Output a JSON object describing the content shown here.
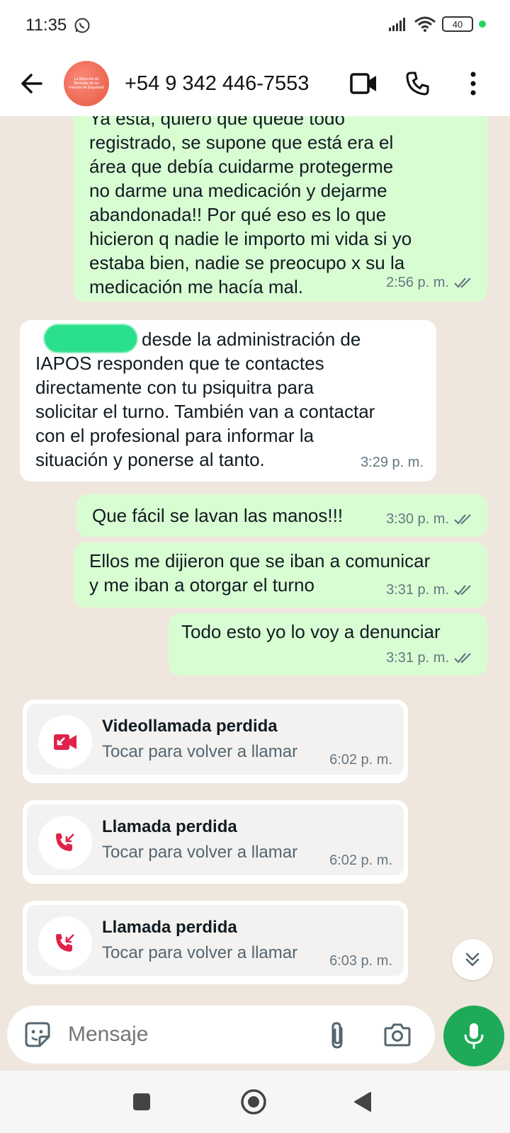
{
  "status_bar": {
    "time": "11:35",
    "battery": "40"
  },
  "header": {
    "contact_name": "+54 9 342 446-7553",
    "avatar_text": "La Dirección de Bienestar de las Fuerzas de Seguridad"
  },
  "messages": [
    {
      "direction": "out",
      "lines": [
        "Ya está, quiero que quede todo",
        "registrado, se supone que está era el",
        "área que debía cuidarme protegerme",
        "no darme una medicación y dejarme",
        "abandonada!! Por qué eso es lo que",
        "hicieron q nadie le importo mi vida si yo",
        "estaba bien, nadie se preocupo x su la",
        "medicación me hacía mal."
      ],
      "time": "2:56 p. m."
    },
    {
      "direction": "in",
      "lines": [
        "desde la administración  de",
        "IAPOS responden que te contactes",
        "directamente con tu psiquitra para",
        "solicitar el turno. También van a contactar",
        "con el profesional para informar la",
        "situación y ponerse al tanto."
      ],
      "time": "3:29 p. m."
    },
    {
      "direction": "out",
      "lines": [
        "Que fácil se lavan las manos!!!"
      ],
      "time": "3:30 p. m."
    },
    {
      "direction": "out",
      "lines": [
        "Ellos me dijieron que se iban a comunicar",
        "y me iban a otorgar el turno"
      ],
      "time": "3:31 p. m."
    },
    {
      "direction": "out",
      "lines": [
        "Todo esto yo lo voy a denunciar"
      ],
      "time": "3:31 p. m."
    }
  ],
  "calls": [
    {
      "title": "Videollamada perdida",
      "subtitle": "Tocar para volver a llamar",
      "time": "6:02 p. m.",
      "icon": "missed-video-call-icon"
    },
    {
      "title": "Llamada perdida",
      "subtitle": "Tocar para volver a llamar",
      "time": "6:02 p. m.",
      "icon": "missed-call-icon"
    },
    {
      "title": "Llamada perdida",
      "subtitle": "Tocar para volver a llamar",
      "time": "6:03 p. m.",
      "icon": "missed-call-icon"
    }
  ],
  "input": {
    "placeholder": "Mensaje"
  },
  "colors": {
    "outgoing": "#d9fdd3",
    "incoming": "#ffffff",
    "missed": "#e0224a",
    "mic": "#1faa59",
    "ticks": "#667781"
  }
}
